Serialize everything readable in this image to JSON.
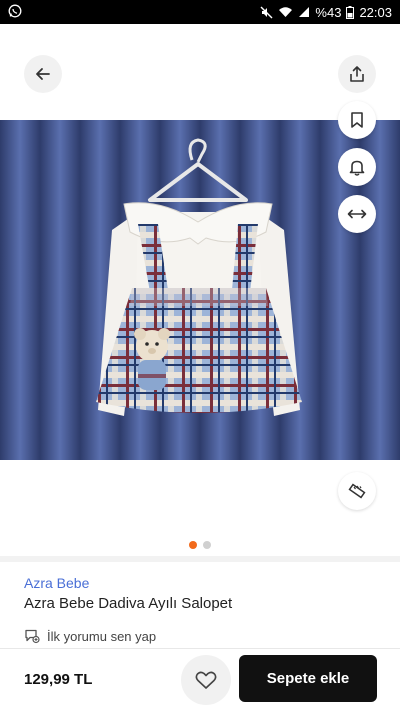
{
  "status_bar": {
    "battery": "%43",
    "time": "22:03",
    "icons": [
      "whatsapp-icon",
      "mute-icon",
      "wifi-icon",
      "signal-icon",
      "battery-icon"
    ]
  },
  "toolbar": {
    "back_icon": "arrow-left-icon",
    "share_icon": "share-icon",
    "bookmark_icon": "bookmark-icon",
    "notify_icon": "bell-icon",
    "compare_icon": "compare-arrows-icon",
    "size_guide_icon": "ruler-icon"
  },
  "gallery": {
    "image_count": 2,
    "active_index": 0
  },
  "product": {
    "brand": "Azra Bebe",
    "name": "Azra Bebe Dadiva Ayılı Salopet",
    "review_prompt": "İlk yorumu sen yap"
  },
  "purchase": {
    "price": "129,99 TL",
    "add_to_cart": "Sepete ekle"
  },
  "colors": {
    "brand_link": "#4a6fd6",
    "active_dot": "#f26a1b",
    "cart_button": "#111111"
  }
}
